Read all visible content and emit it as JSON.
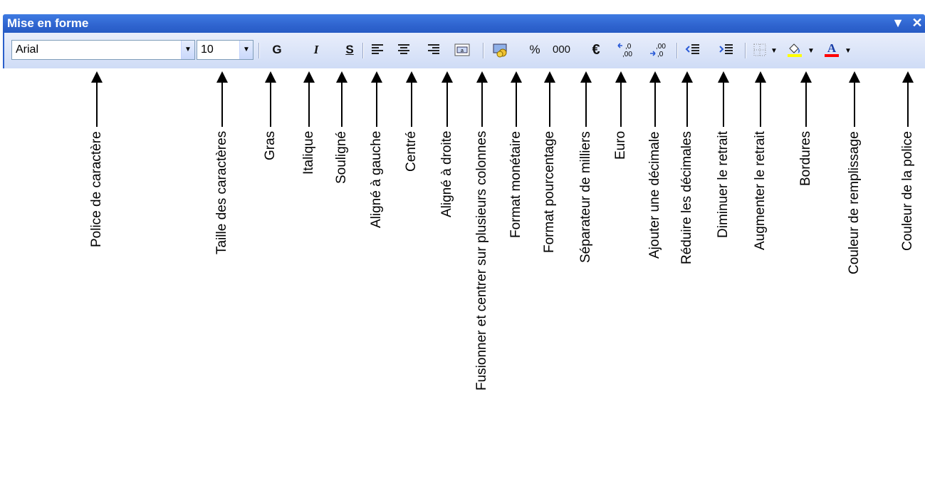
{
  "toolbar": {
    "title": "Mise en forme",
    "title_menu_icon": "▼",
    "title_close_icon": "✕",
    "font_name": "Arial",
    "font_size": "10",
    "bold": "G",
    "italic": "I",
    "underline": "S",
    "percent": "%",
    "thousands": "000",
    "euro": "€",
    "add_decimal": "↞,0",
    "remove_decimal": ",00"
  },
  "callouts": [
    {
      "label": "Police de caractère"
    },
    {
      "label": "Taille des caractères"
    },
    {
      "label": "Gras"
    },
    {
      "label": "Italique"
    },
    {
      "label": "Souligné"
    },
    {
      "label": "Aligné à gauche"
    },
    {
      "label": "Centré"
    },
    {
      "label": "Aligné à droite"
    },
    {
      "label": "Fusionner et centrer sur plusieurs colonnes"
    },
    {
      "label": "Format monétaire"
    },
    {
      "label": "Format pourcentage"
    },
    {
      "label": "Séparateur de milliers"
    },
    {
      "label": "Euro"
    },
    {
      "label": "Ajouter une décimale"
    },
    {
      "label": "Réduire les décimales"
    },
    {
      "label": "Diminuer le retrait"
    },
    {
      "label": "Augmenter le retrait"
    },
    {
      "label": "Bordures"
    },
    {
      "label": "Couleur de remplissage"
    },
    {
      "label": "Couleur de la police"
    }
  ]
}
